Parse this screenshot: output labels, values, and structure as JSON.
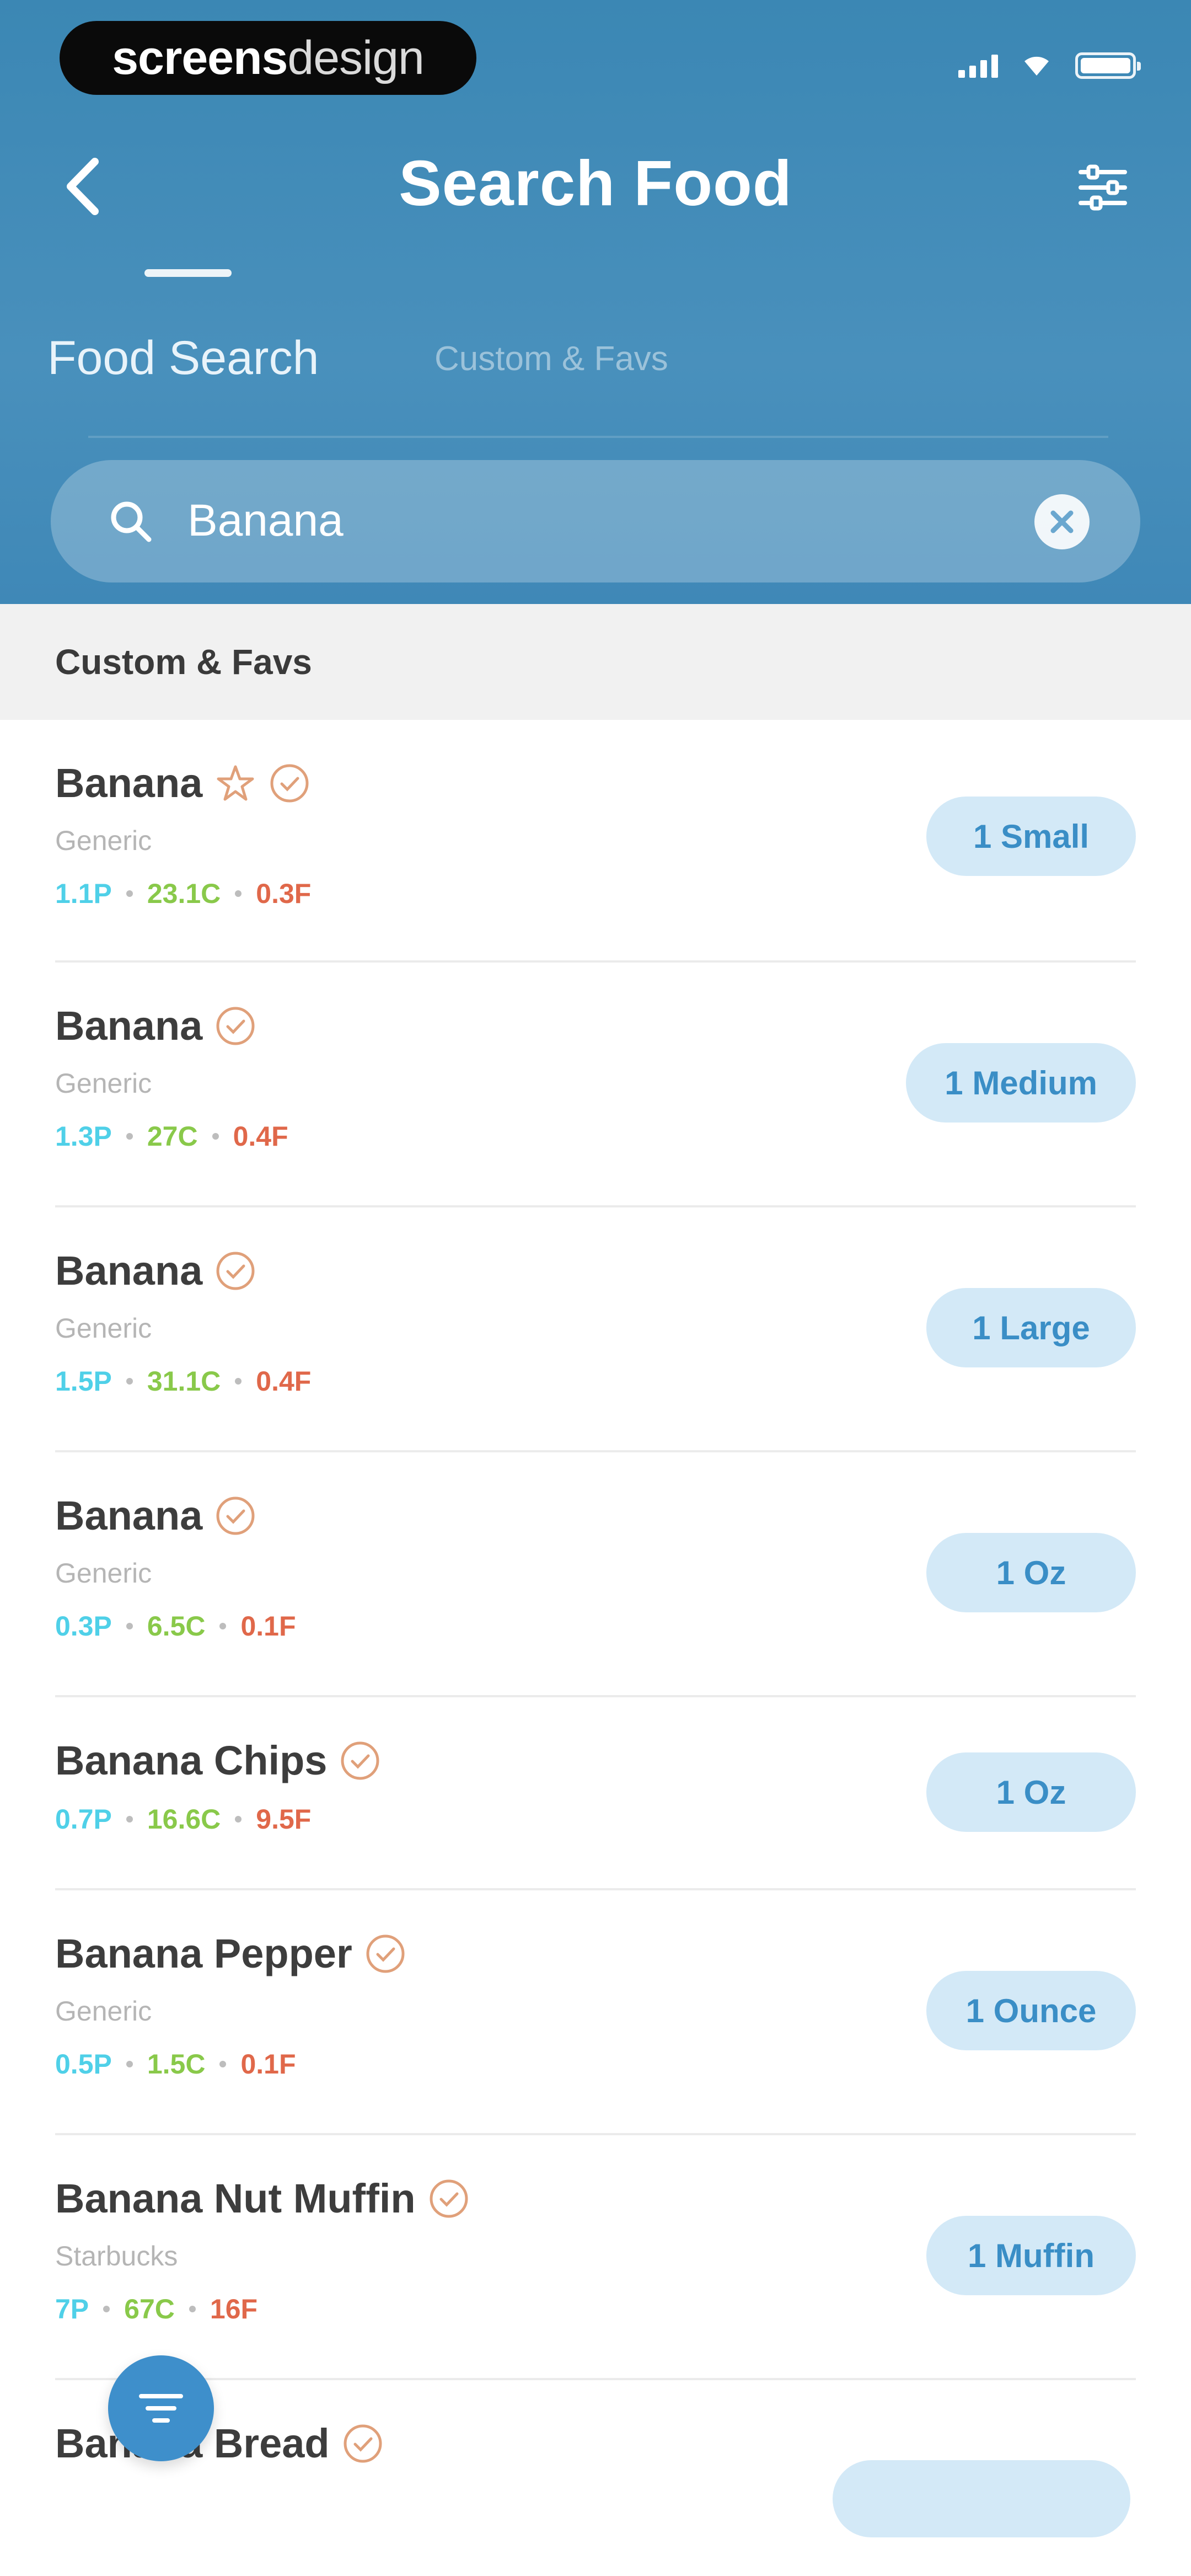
{
  "status_bar": {
    "badge_bold": "screens",
    "badge_light": "design"
  },
  "header": {
    "title": "Search Food",
    "tabs": [
      {
        "label": "Food Search",
        "active": true
      },
      {
        "label": "Custom & Favs",
        "active": false
      }
    ]
  },
  "search": {
    "value": "Banana"
  },
  "section": {
    "title": "Custom & Favs"
  },
  "results": [
    {
      "name": "Banana",
      "favorite": true,
      "source": "Generic",
      "protein": "1.1P",
      "carbs": "23.1C",
      "fat": "0.3F",
      "serving": "1 Small"
    },
    {
      "name": "Banana",
      "favorite": false,
      "source": "Generic",
      "protein": "1.3P",
      "carbs": "27C",
      "fat": "0.4F",
      "serving": "1 Medium"
    },
    {
      "name": "Banana",
      "favorite": false,
      "source": "Generic",
      "protein": "1.5P",
      "carbs": "31.1C",
      "fat": "0.4F",
      "serving": "1 Large"
    },
    {
      "name": "Banana",
      "favorite": false,
      "source": "Generic",
      "protein": "0.3P",
      "carbs": "6.5C",
      "fat": "0.1F",
      "serving": "1 Oz"
    },
    {
      "name": "Banana Chips",
      "favorite": false,
      "source": "",
      "protein": "0.7P",
      "carbs": "16.6C",
      "fat": "9.5F",
      "serving": "1 Oz"
    },
    {
      "name": "Banana Pepper",
      "favorite": false,
      "source": "Generic",
      "protein": "0.5P",
      "carbs": "1.5C",
      "fat": "0.1F",
      "serving": "1 Ounce"
    },
    {
      "name": "Banana Nut Muffin",
      "favorite": false,
      "source": "Starbucks",
      "protein": "7P",
      "carbs": "67C",
      "fat": "16F",
      "serving": "1 Muffin"
    },
    {
      "name": "Banana Bread",
      "favorite": false,
      "source": "",
      "protein": "",
      "carbs": "",
      "fat": "",
      "serving": ""
    }
  ],
  "colors": {
    "header": "#3f89b7",
    "protein": "#4fd0e8",
    "carbs": "#89c94a",
    "fat": "#e0684a",
    "pill_bg": "#d3e9f7",
    "pill_text": "#3a8ec6",
    "verified": "#e0a07a"
  },
  "icons": {
    "back": "back-arrow-icon",
    "filter": "filter-sliders-icon",
    "search": "search-icon",
    "clear": "clear-circle-icon",
    "verified": "verified-check-icon",
    "favorite": "star-icon",
    "fab": "filter-funnel-icon"
  }
}
